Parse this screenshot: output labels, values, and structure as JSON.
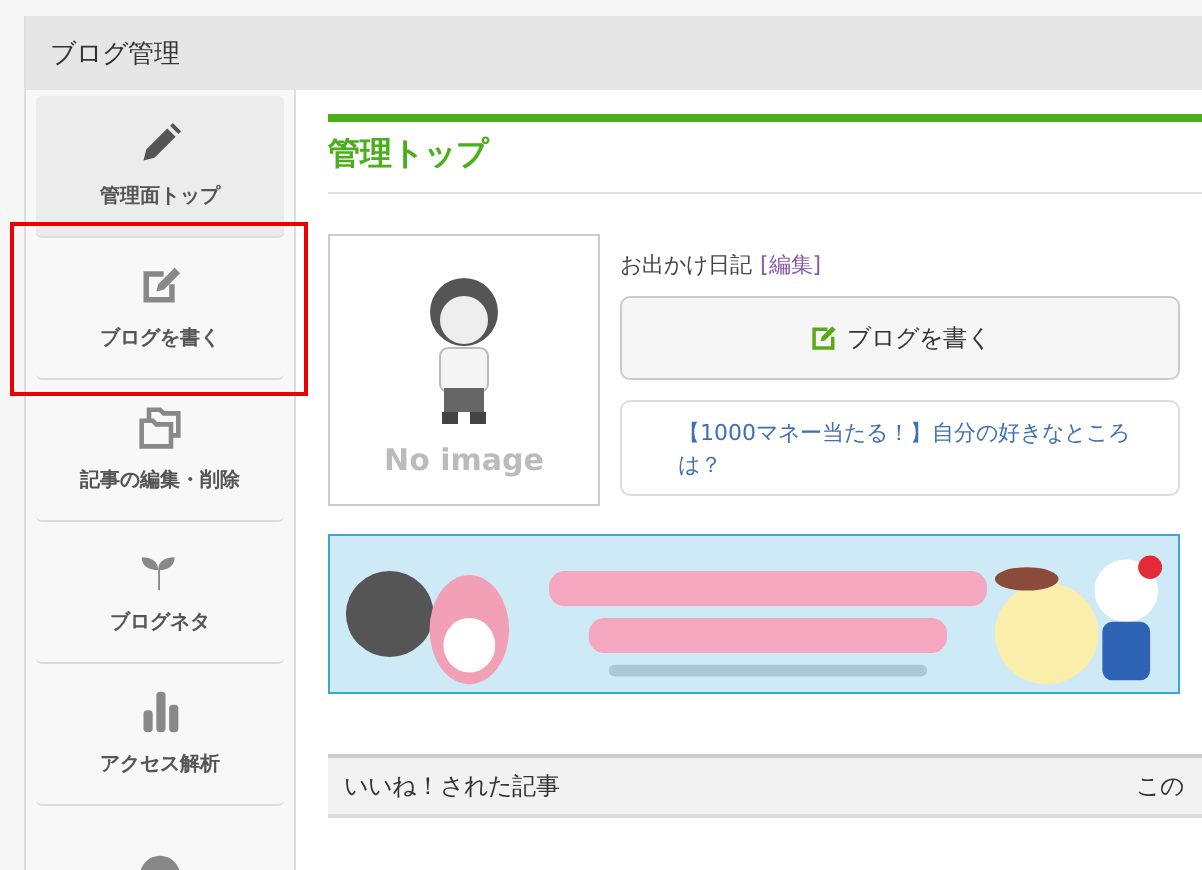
{
  "panel": {
    "title": "ブログ管理"
  },
  "sidebar": {
    "items": [
      {
        "kind": "pencil",
        "label": "管理面トップ",
        "selected": true,
        "highlighted": false
      },
      {
        "kind": "edit",
        "label": "ブログを書く",
        "selected": false,
        "highlighted": true
      },
      {
        "kind": "folders",
        "label": "記事の編集・削除",
        "selected": false,
        "highlighted": false
      },
      {
        "kind": "sprout",
        "label": "ブログネタ",
        "selected": false,
        "highlighted": false
      },
      {
        "kind": "bars",
        "label": "アクセス解析",
        "selected": false,
        "highlighted": false
      },
      {
        "kind": "circle",
        "selected": false,
        "highlighted": false
      }
    ]
  },
  "main": {
    "heading": "管理トップ",
    "profile": {
      "placeholder_text": "No image",
      "blog_name": "お出かけ日記",
      "edit_link": "[編集]",
      "write_button": "ブログを書く",
      "topic_link": "【1000マネー当たる！】自分の好きなところは？"
    },
    "liked": {
      "title": "いいね！された記事",
      "column_2": "この"
    }
  }
}
